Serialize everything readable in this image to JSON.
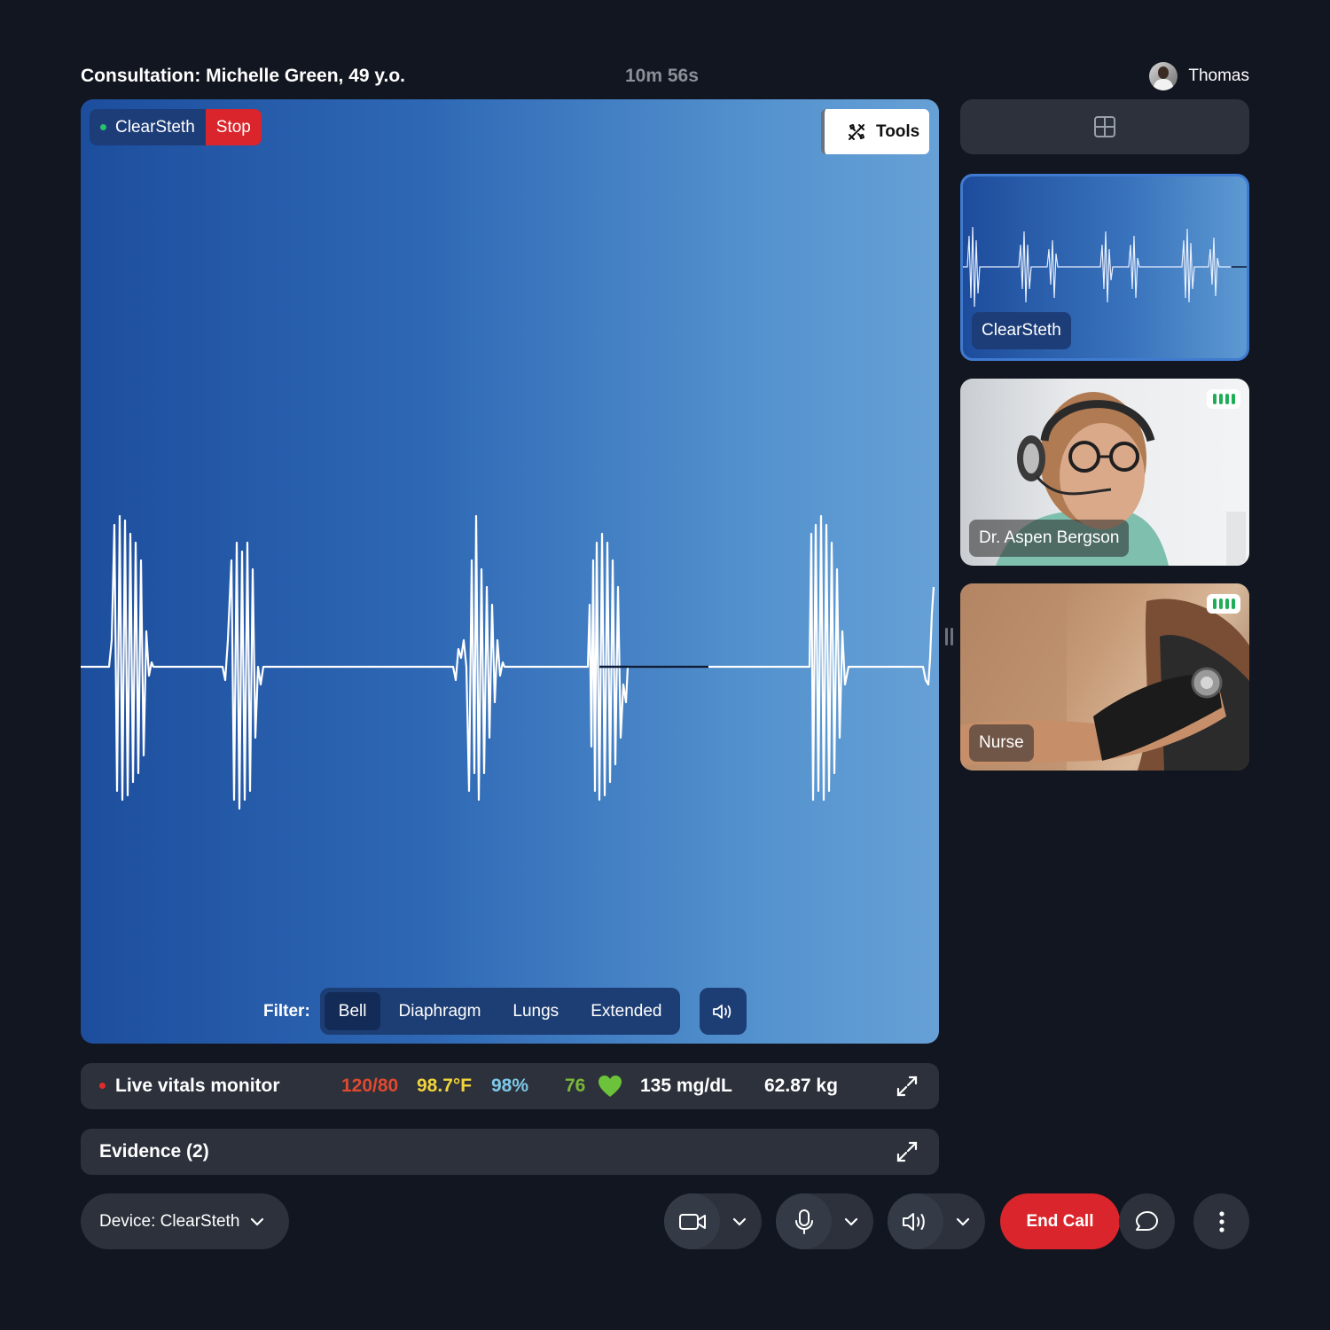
{
  "header": {
    "title": "Consultation: Michelle Green, 49 y.o.",
    "timer": "10m 56s",
    "user_name": "Thomas"
  },
  "stage": {
    "source_label": "ClearSteth",
    "stop_label": "Stop",
    "tools_label": "Tools",
    "filter_label": "Filter:",
    "filters": [
      "Bell",
      "Diaphragm",
      "Lungs",
      "Extended"
    ],
    "active_filter": "Bell"
  },
  "participants": [
    {
      "name": "ClearSteth",
      "type": "stethoscope"
    },
    {
      "name": "Dr. Aspen Bergson",
      "type": "video"
    },
    {
      "name": "Nurse",
      "type": "video"
    }
  ],
  "vitals": {
    "title": "Live vitals monitor",
    "blood_pressure": "120/80",
    "temperature": "98.7°F",
    "spo2": "98%",
    "heart_rate": "76",
    "glucose": "135 mg/dL",
    "weight": "62.87 kg",
    "colors": {
      "bp": "#e0492f",
      "temp": "#f2d43a",
      "spo2": "#7ec8e8",
      "hr": "#7ab83a",
      "heart": "#6cc23a"
    }
  },
  "evidence": {
    "title": "Evidence (2)"
  },
  "controls": {
    "device_label": "Device: ClearSteth",
    "end_call_label": "End Call"
  },
  "colors": {
    "end_call": "#d9252b",
    "stop": "#d9252b",
    "live_dot": "#27c26b"
  }
}
